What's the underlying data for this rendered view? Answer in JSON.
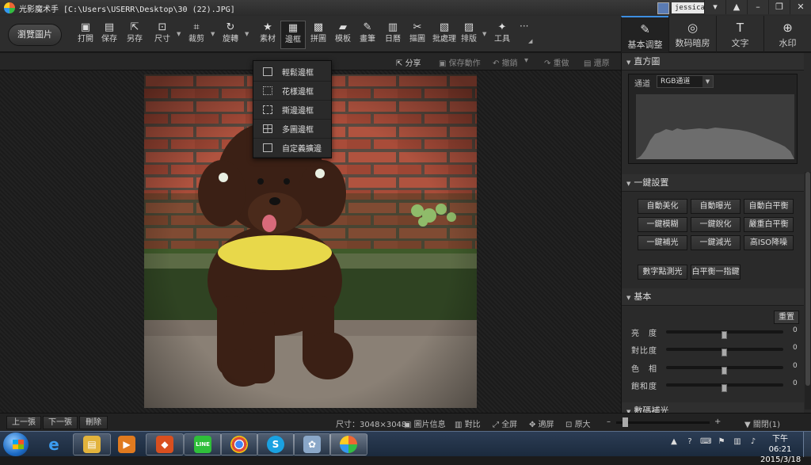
{
  "window": {
    "title": "光影魔术手  [C:\\Users\\USERR\\Desktop\\30 (22).JPG]",
    "user": "jessica",
    "controls": [
      "▾",
      "▲",
      "–",
      "❐",
      "✕"
    ]
  },
  "toolbar": {
    "open_label": "瀏覽圖片",
    "tools": [
      {
        "label": "打開",
        "icon": "▣"
      },
      {
        "label": "保存",
        "icon": "▤"
      },
      {
        "label": "另存",
        "icon": "⇱"
      },
      {
        "label": "尺寸",
        "icon": "⊡"
      },
      {
        "label": "裁剪",
        "icon": "⌗"
      },
      {
        "label": "旋轉",
        "icon": "↻"
      },
      {
        "label": "素材",
        "icon": "★"
      },
      {
        "label": "邊框",
        "icon": "▦"
      },
      {
        "label": "拼圖",
        "icon": "▩"
      },
      {
        "label": "模板",
        "icon": "▰"
      },
      {
        "label": "畫筆",
        "icon": "✎"
      },
      {
        "label": "日曆",
        "icon": "▥"
      },
      {
        "label": "摳圖",
        "icon": "✂"
      },
      {
        "label": "批處理",
        "icon": "▧"
      },
      {
        "label": "排版",
        "icon": "▨"
      },
      {
        "label": "工具",
        "icon": "✦"
      }
    ],
    "more": "···"
  },
  "panel_tabs": [
    {
      "label": "基本调整",
      "icon": "✎"
    },
    {
      "label": "数码暗房",
      "icon": "◎"
    },
    {
      "label": "文字",
      "icon": "T"
    },
    {
      "label": "水印",
      "icon": "⊕"
    }
  ],
  "subbar": {
    "share": "分享",
    "save_action": "保存動作",
    "undo": "撤銷",
    "redo": "重做",
    "restore": "還原"
  },
  "frame_menu": {
    "items": [
      "輕鬆邊框",
      "花樣邊框",
      "撕邊邊框",
      "多圖邊框",
      "自定義擴邊"
    ]
  },
  "right_panel": {
    "histogram": {
      "title": "直方圖",
      "channel_label": "通道",
      "channel_value": "RGB通道"
    },
    "one_click": {
      "title": "一鍵設置",
      "buttons": [
        "自動美化",
        "自動曝光",
        "自動白平衡",
        "一鍵模糊",
        "一鍵銳化",
        "嚴重白平衡",
        "一鍵補光",
        "一鍵減光",
        "高ISO降噪",
        "數字點測光",
        "白平衡一指鍵"
      ]
    },
    "basic": {
      "title": "基本",
      "reset": "重置",
      "sliders": [
        {
          "label": "亮　度",
          "value": 0,
          "position": 0.5
        },
        {
          "label": "對比度",
          "value": 0,
          "position": 0.5
        },
        {
          "label": "色　相",
          "value": 0,
          "position": 0.5
        },
        {
          "label": "飽和度",
          "value": 0,
          "position": 0.5
        }
      ]
    },
    "next_section": "數碼補光"
  },
  "statusbar": {
    "prev": "上一張",
    "next": "下一張",
    "delete": "刪除",
    "size": "尺寸：3048×3048",
    "info": "圖片信息",
    "compare": "對比",
    "fullscreen": "全屏",
    "fit": "適屏",
    "actual": "原大",
    "zoom_minus": "–",
    "zoom_plus": "+",
    "close_label": "關閉(1)"
  },
  "taskbar": {
    "apps": [
      {
        "name": "ie",
        "glyph": "e",
        "color": "#2a7fd4"
      },
      {
        "name": "explorer",
        "glyph": "▤",
        "color": "#e2b33c"
      },
      {
        "name": "media",
        "glyph": "▶",
        "color": "#e07a1f"
      },
      {
        "name": "app-orange",
        "glyph": "◆",
        "color": "#d94f1f"
      },
      {
        "name": "line",
        "glyph": "LINE",
        "color": "#2fbf3a"
      },
      {
        "name": "chrome",
        "glyph": "◉",
        "color": "#dd4b39"
      },
      {
        "name": "skype",
        "glyph": "S",
        "color": "#1aa1e1"
      },
      {
        "name": "paint",
        "glyph": "✿",
        "color": "#8aa7c8"
      },
      {
        "name": "neoimaging",
        "glyph": "◐",
        "color": "#d33"
      }
    ],
    "time": "下午 06:21",
    "date": "2015/3/18"
  },
  "colors": {
    "accent": "#3d8ee0",
    "panel_bg": "#2a2a2a",
    "toolbar_bg": "#2d2d2d"
  }
}
